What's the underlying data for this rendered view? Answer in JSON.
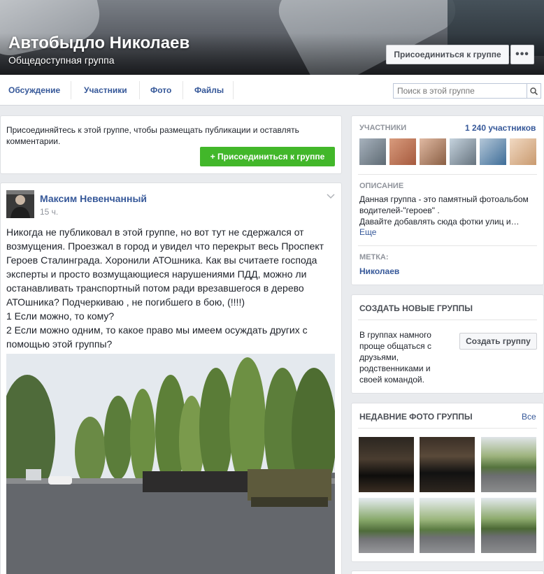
{
  "cover": {
    "title": "Автобыдло Николаев",
    "subtitle": "Общедоступная группа",
    "join_label": "Присоединиться к группе",
    "more_label": "•••"
  },
  "nav": {
    "tabs": [
      {
        "label": "Обсуждение"
      },
      {
        "label": "Участники"
      },
      {
        "label": "Фото"
      },
      {
        "label": "Файлы"
      }
    ],
    "search_placeholder": "Поиск в этой группе",
    "search_icon": "search-icon"
  },
  "join_box": {
    "text": "Присоединяйтесь к этой группе, чтобы размещать публикации и оставлять комментарии.",
    "button_label": "+ Присоединиться к группе"
  },
  "post": {
    "author": "Максим Невенчанный",
    "time": "15 ч.",
    "text_lines": [
      "Никогда не публиковал в этой группе, но вот тут не сдержался от",
      "возмущения. Проезжал в город и увидел что перекрыт весь Проспект",
      "Героев Сталинграда. Хоронили АТОшника. Как вы считаете господа",
      "эксперты и просто возмущающиеся нарушениями ПДД, можно ли",
      "останавливать транспортный потом ради врезавшегося в дерево",
      "АТОшника? Подчеркиваю , не погибшего в бою, (!!!!)",
      "1 Если можно, то кому?",
      "2 Если можно одним, то какое право мы имеем осуждать других с",
      "помощью этой группы?"
    ]
  },
  "members": {
    "heading": "УЧАСТНИКИ",
    "count_label": "1 240 участников"
  },
  "description": {
    "heading": "ОПИСАНИЕ",
    "lines": [
      "Данная группа - это памятный фотоальбом",
      "водителей-\"героев\" .",
      "Давайте добавлять сюда фотки улиц и…"
    ],
    "more_link": "Еще"
  },
  "tag": {
    "heading": "МЕТКА:",
    "value": "Николаев"
  },
  "create_groups": {
    "heading": "СОЗДАТЬ НОВЫЕ ГРУППЫ",
    "lines": [
      "В группах намного",
      "проще общаться с",
      "друзьями,",
      "родственниками и",
      "своей командой."
    ],
    "button_label": "Создать группу"
  },
  "recent_photos": {
    "heading": "НЕДАВНИЕ ФОТО ГРУППЫ",
    "all_link": "Все"
  },
  "colors": {
    "link": "#365899",
    "join_green": "#42b72a",
    "page_bg": "#e9ebee"
  }
}
